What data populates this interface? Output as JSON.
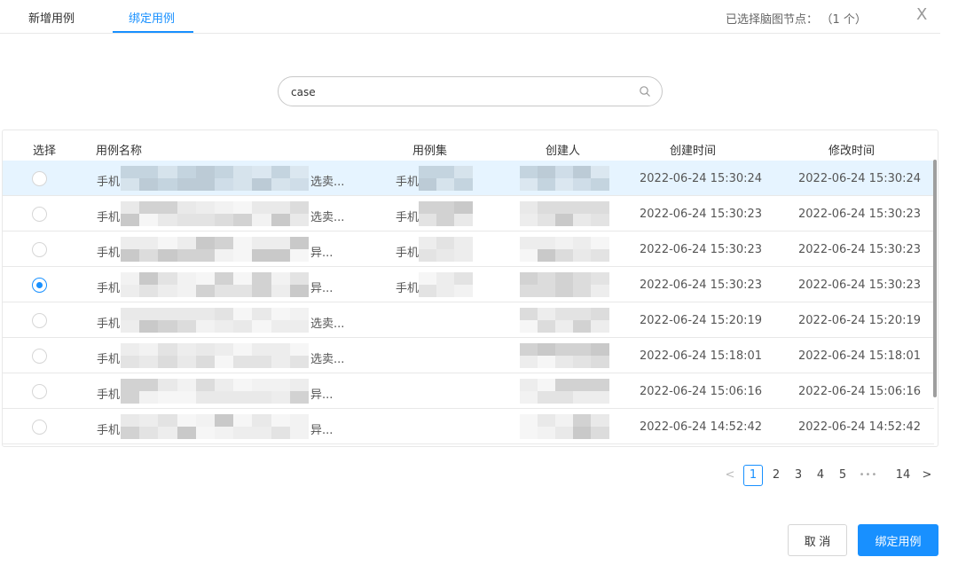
{
  "tabs": {
    "new_case": "新增用例",
    "bind_case": "绑定用例"
  },
  "header": {
    "selected_label": "已选择脑图节点：",
    "selected_count": "（1 个）",
    "close": "X"
  },
  "search": {
    "value": "case"
  },
  "table": {
    "headers": {
      "select": "选择",
      "name": "用例名称",
      "case_set": "用例集",
      "creator": "创建人",
      "created_at": "创建时间",
      "modified_at": "修改时间"
    },
    "rows": [
      {
        "name_prefix": "手机",
        "name_suffix": "选卖...",
        "set_prefix": "手机",
        "created_at": "2022-06-24 15:30:24",
        "modified_at": "2022-06-24 15:30:24",
        "selected": false,
        "highlighted": true
      },
      {
        "name_prefix": "手机",
        "name_suffix": "选卖...",
        "set_prefix": "手机",
        "created_at": "2022-06-24 15:30:23",
        "modified_at": "2022-06-24 15:30:23",
        "selected": false,
        "highlighted": false
      },
      {
        "name_prefix": "手机",
        "name_suffix": "异...",
        "set_prefix": "手机",
        "created_at": "2022-06-24 15:30:23",
        "modified_at": "2022-06-24 15:30:23",
        "selected": false,
        "highlighted": false
      },
      {
        "name_prefix": "手机",
        "name_suffix": "异...",
        "set_prefix": "手机",
        "created_at": "2022-06-24 15:30:23",
        "modified_at": "2022-06-24 15:30:23",
        "selected": true,
        "highlighted": false
      },
      {
        "name_prefix": "手机",
        "name_suffix": "选卖...",
        "set_prefix": "",
        "created_at": "2022-06-24 15:20:19",
        "modified_at": "2022-06-24 15:20:19",
        "selected": false,
        "highlighted": false
      },
      {
        "name_prefix": "手机",
        "name_suffix": "选卖...",
        "set_prefix": "",
        "created_at": "2022-06-24 15:18:01",
        "modified_at": "2022-06-24 15:18:01",
        "selected": false,
        "highlighted": false
      },
      {
        "name_prefix": "手机",
        "name_suffix": "异...",
        "set_prefix": "",
        "created_at": "2022-06-24 15:06:16",
        "modified_at": "2022-06-24 15:06:16",
        "selected": false,
        "highlighted": false
      },
      {
        "name_prefix": "手机",
        "name_suffix": "异...",
        "set_prefix": "",
        "created_at": "2022-06-24 14:52:42",
        "modified_at": "2022-06-24 14:52:42",
        "selected": false,
        "highlighted": false
      }
    ]
  },
  "pagination": {
    "prev": "<",
    "pages": [
      "1",
      "2",
      "3",
      "4",
      "5"
    ],
    "current": "1",
    "ellipsis": "•••",
    "last": "14",
    "next": ">"
  },
  "buttons": {
    "cancel": "取 消",
    "bind": "绑定用例"
  },
  "colors": {
    "accent": "#1890ff",
    "row_highlight": "#e6f4ff"
  },
  "icons": {
    "search": "search-icon",
    "close": "close-icon"
  }
}
